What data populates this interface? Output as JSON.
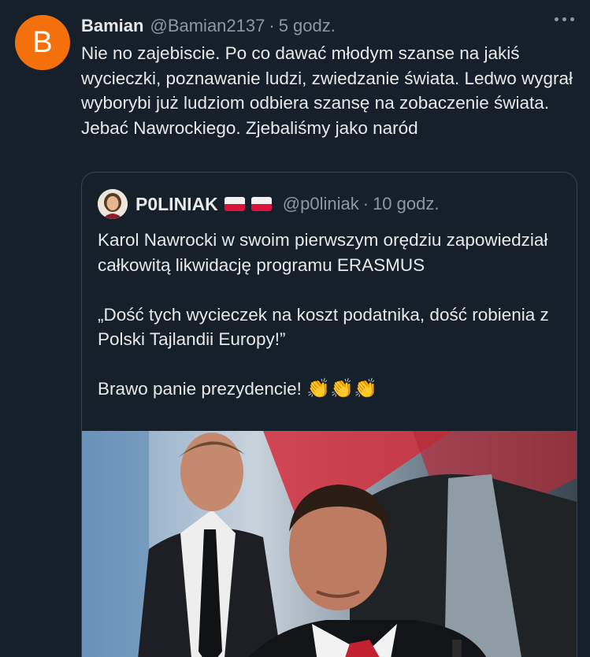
{
  "tweet": {
    "avatar_letter": "B",
    "avatar_color": "#f4700c",
    "display_name": "Bamian",
    "handle": "@Bamian2137",
    "separator": "·",
    "time": "5 godz.",
    "more_icon": "more-horizontal-icon",
    "text": "Nie no zajebiscie. Po co dawać młodym szanse na jakiś wycieczki, poznawanie ludzi, zwiedzanie świata. Ledwo wygrał wyborybi już ludziom odbiera szansę na zobaczenie świata. Jebać Nawrockiego. Zjebaliśmy jako naród"
  },
  "quoted_tweet": {
    "display_name": "P0LINIAK",
    "flags": [
      "poland-flag-icon",
      "poland-flag-icon"
    ],
    "handle": "@p0liniak",
    "separator": "·",
    "time": "10 godz.",
    "text_line1": "Karol Nawrocki w swoim pierwszym orędziu zapowiedział całkowitą likwidację programu ERASMUS",
    "text_quote": "„Dość tych wycieczek na koszt podatnika, dość robienia z Polski Tajlandii Europy!”",
    "text_final": "Brawo panie prezydencie!",
    "clap_emoji": "👏👏👏"
  },
  "colors": {
    "background": "#15202b",
    "text_primary": "#e7e9ea",
    "text_secondary": "#8b98a5",
    "border": "#38444d"
  }
}
